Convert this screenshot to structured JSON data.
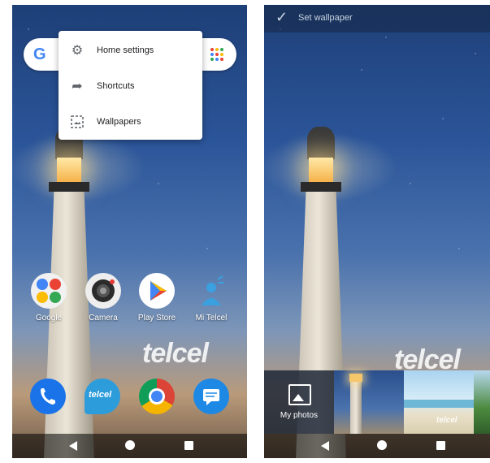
{
  "left_screen": {
    "menu": [
      {
        "label": "Home settings",
        "icon": "gear-icon"
      },
      {
        "label": "Shortcuts",
        "icon": "arrow-icon"
      },
      {
        "label": "Wallpapers",
        "icon": "wallpaper-icon"
      }
    ],
    "apps": [
      {
        "label": "Google"
      },
      {
        "label": "Camera"
      },
      {
        "label": "Play Store"
      },
      {
        "label": "Mi Telcel"
      }
    ],
    "watermark": "telcel",
    "dock_badge": "telcel"
  },
  "right_screen": {
    "top_action": "Set wallpaper",
    "my_photos_label": "My photos",
    "watermark": "telcel",
    "thumb_watermark": "telcel"
  },
  "colors": {
    "phone_blue": "#1a73e8",
    "chrome_red": "#db4437",
    "chrome_yellow": "#f4b400",
    "chrome_green": "#0f9d58",
    "messages_blue": "#1e88e5",
    "telcel_blue": "#2d9cdb"
  }
}
